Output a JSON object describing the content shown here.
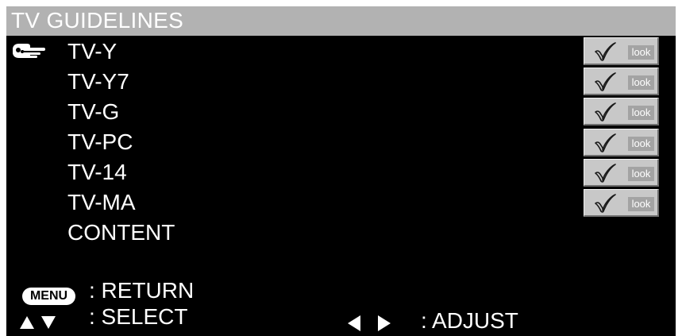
{
  "header": {
    "title": "TV GUIDELINES"
  },
  "cursor": {
    "icon": "hand-pointer-icon",
    "selected_index": 0
  },
  "ratings": [
    {
      "label": "TV-Y",
      "lock": {
        "icon": "check-icon",
        "label": "look"
      }
    },
    {
      "label": "TV-Y7",
      "lock": {
        "icon": "check-icon",
        "label": "look"
      }
    },
    {
      "label": "TV-G",
      "lock": {
        "icon": "check-icon",
        "label": "look"
      }
    },
    {
      "label": "TV-PC",
      "lock": {
        "icon": "check-icon",
        "label": "look"
      }
    },
    {
      "label": "TV-14",
      "lock": {
        "icon": "check-icon",
        "label": "look"
      }
    },
    {
      "label": "TV-MA",
      "lock": {
        "icon": "check-icon",
        "label": "look"
      }
    },
    {
      "label": "CONTENT"
    }
  ],
  "footer": {
    "menu_key": "MENU",
    "return_label": ": RETURN",
    "select_label": ": SELECT",
    "adjust_label": ": ADJUST",
    "select_icons": [
      "triangle-up-icon",
      "triangle-down-icon"
    ],
    "adjust_icons": [
      "triangle-left-icon",
      "triangle-right-icon"
    ]
  },
  "colors": {
    "screen_bg": "#000000",
    "title_bar": "#b2b2b2",
    "text": "#ffffff",
    "lock_button": "#c8c8c8",
    "lock_label_bg": "#a3a3a3"
  }
}
